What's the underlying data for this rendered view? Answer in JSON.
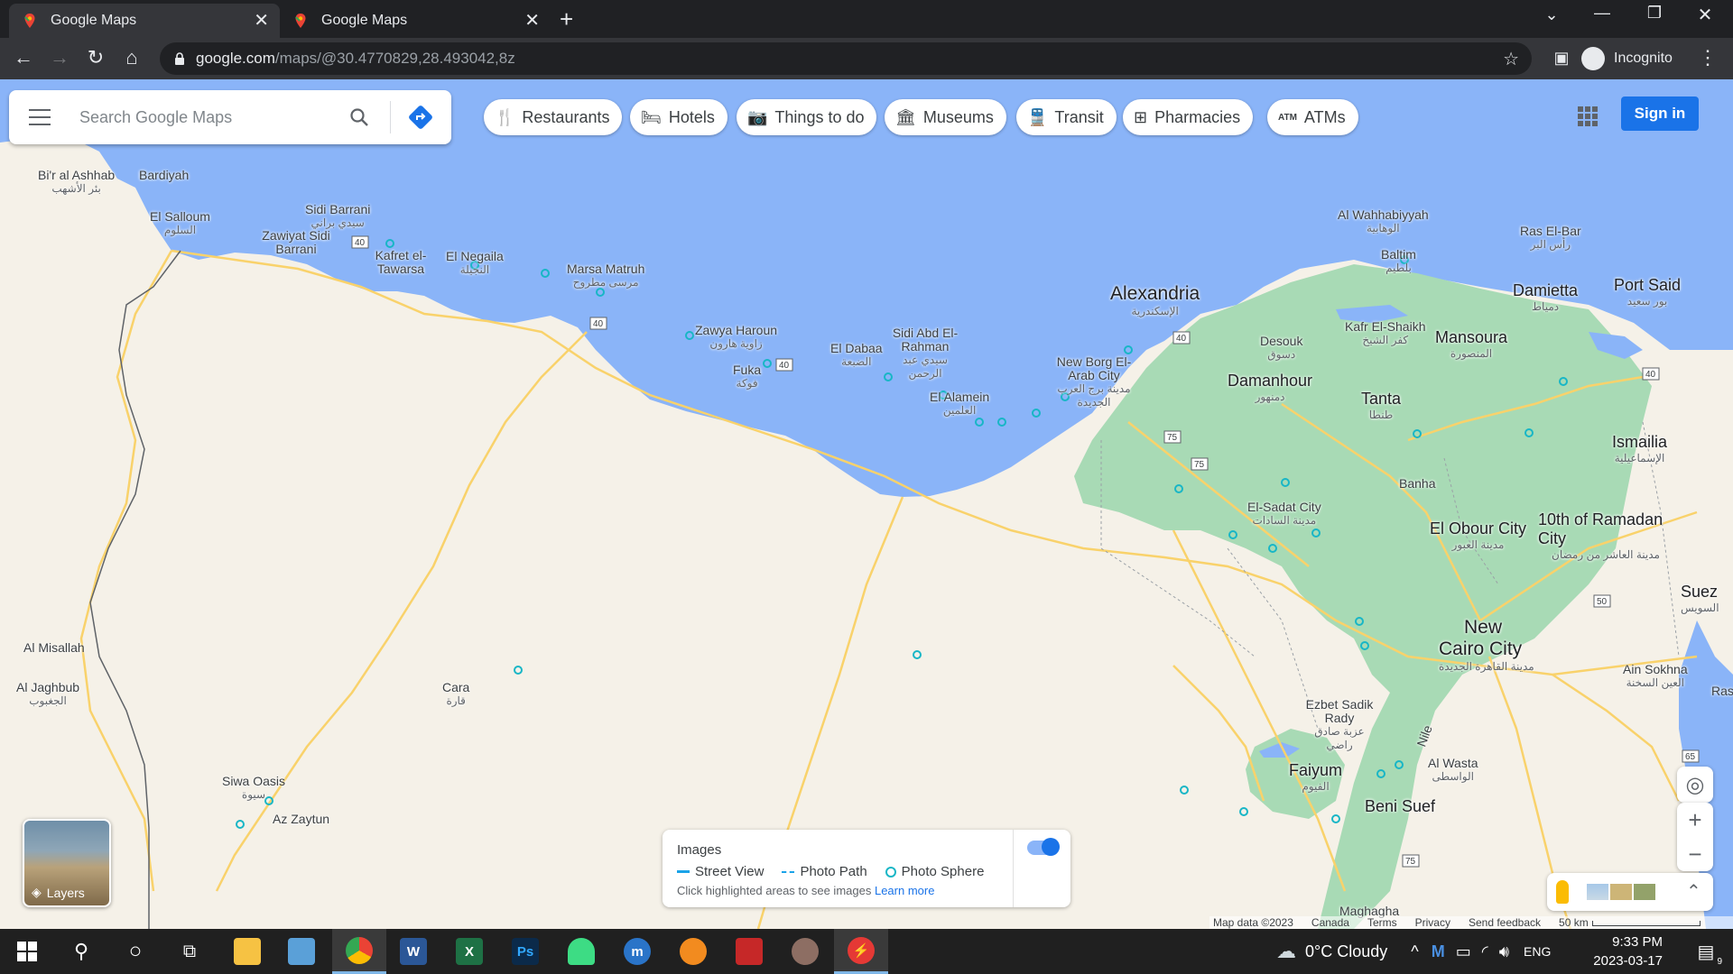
{
  "browser": {
    "tabs": [
      {
        "label": "Google Maps",
        "active": true
      },
      {
        "label": "Google Maps",
        "active": false
      }
    ],
    "url_host": "google.com",
    "url_path": "/maps/@30.4770829,28.493042,8z",
    "incognito_label": "Incognito"
  },
  "maps": {
    "search_placeholder": "Search Google Maps",
    "chips": [
      {
        "label": "Restaurants",
        "icon": "fork-knife-icon"
      },
      {
        "label": "Hotels",
        "icon": "bed-icon"
      },
      {
        "label": "Things to do",
        "icon": "camera-icon"
      },
      {
        "label": "Museums",
        "icon": "museum-icon"
      },
      {
        "label": "Transit",
        "icon": "train-icon"
      },
      {
        "label": "Pharmacies",
        "icon": "pharmacy-icon"
      },
      {
        "label": "ATMs",
        "icon": "atm-icon"
      }
    ],
    "signin_label": "Sign in",
    "layers_label": "Layers",
    "images_panel": {
      "title": "Images",
      "street_view": "Street View",
      "photo_path": "Photo Path",
      "photo_sphere": "Photo Sphere",
      "hint": "Click highlighted areas to see images",
      "learn_more": "Learn more"
    },
    "footer": {
      "map_data": "Map data ©2023",
      "region": "Canada",
      "terms": "Terms",
      "privacy": "Privacy",
      "feedback": "Send feedback",
      "scale": "50 km"
    },
    "places": {
      "alexandria": {
        "name": "Alexandria",
        "ar": "الإسكندرية"
      },
      "cairo1": {
        "name": "New",
        "ar": ""
      },
      "cairo2": {
        "name": "Cairo City",
        "ar": "مدينة القاهرة الجديدة"
      },
      "mansoura": {
        "name": "Mansoura",
        "ar": "المنصورة"
      },
      "damanhour": {
        "name": "Damanhour",
        "ar": "دمنهور"
      },
      "tanta": {
        "name": "Tanta",
        "ar": "طنطا"
      },
      "damietta": {
        "name": "Damietta",
        "ar": "دمياط"
      },
      "portsaid": {
        "name": "Port Said",
        "ar": "بور سعيد"
      },
      "ismailia": {
        "name": "Ismailia",
        "ar": "الإسماعيلية"
      },
      "obour": {
        "name": "El Obour City",
        "ar": "مدينة العبور"
      },
      "ramadan": {
        "name": "10th of Ramadan City",
        "ar": "مدينة العاشر من رمضان"
      },
      "suez": {
        "name": "Suez",
        "ar": "السويس"
      },
      "faiyum": {
        "name": "Faiyum",
        "ar": "الفيوم"
      },
      "benisuef": {
        "name": "Beni Suef",
        "ar": ""
      },
      "marsa": {
        "name": "Marsa Matruh",
        "ar": "مرسى مطروح"
      },
      "siwa": {
        "name": "Siwa Oasis",
        "ar": "سيوة"
      },
      "sidibarrani": {
        "name": "Sidi Barrani",
        "ar": "سيدي براني"
      },
      "salloum": {
        "name": "El Salloum",
        "ar": "السلوم"
      },
      "bardiyah": {
        "name": "Bardiyah",
        "ar": ""
      },
      "biralashhab": {
        "name": "Bi'r al Ashhab",
        "ar": "بئر الأشهب"
      },
      "zawiyat": {
        "name": "Zawiyat Sidi Barrani",
        "ar": ""
      },
      "kafret": {
        "name": "Kafret el-Tawarsa",
        "ar": ""
      },
      "negaila": {
        "name": "El Negaila",
        "ar": "النجيلة"
      },
      "zawya": {
        "name": "Zawya Haroun",
        "ar": "زاوية هارون"
      },
      "fuka": {
        "name": "Fuka",
        "ar": "فوكة"
      },
      "dabaa": {
        "name": "El Dabaa",
        "ar": "الضبعة"
      },
      "sidiabd": {
        "name": "Sidi Abd El-Rahman",
        "ar": "سيدي عبد الرحمن"
      },
      "alamein": {
        "name": "El Alamein",
        "ar": "العلمين"
      },
      "newborg": {
        "name": "New Borg El-Arab City",
        "ar": "مدينة برج العرب الجديدة"
      },
      "sadat": {
        "name": "El-Sadat City",
        "ar": "مدينة السادات"
      },
      "banha": {
        "name": "Banha",
        "ar": ""
      },
      "desouk": {
        "name": "Desouk",
        "ar": "دسوق"
      },
      "kafrsheikh": {
        "name": "Kafr El-Shaikh",
        "ar": "كفر الشيخ"
      },
      "baltim": {
        "name": "Baltim",
        "ar": "بلطيم"
      },
      "wahhabiyyah": {
        "name": "Al Wahhabiyyah",
        "ar": "الوهابية"
      },
      "rasbar": {
        "name": "Ras El-Bar",
        "ar": "رأس البر"
      },
      "cara": {
        "name": "Cara",
        "ar": "قارة"
      },
      "azzaytun": {
        "name": "Az Zaytun",
        "ar": ""
      },
      "misallah": {
        "name": "Al Misallah",
        "ar": ""
      },
      "jaghbub": {
        "name": "Al Jaghbub",
        "ar": "الجغبوب"
      },
      "ezbet": {
        "name": "Ezbet Sadik Rady",
        "ar": "عزبة صادق راضي"
      },
      "wasta": {
        "name": "Al Wasta",
        "ar": "الواسطى"
      },
      "ainsokhna": {
        "name": "Ain Sokhna",
        "ar": "العين السخنة"
      },
      "nile": {
        "name": "Nile",
        "ar": ""
      },
      "maghagha": {
        "name": "Maghagha",
        "ar": ""
      },
      "ras": {
        "name": "Ras",
        "ar": ""
      }
    }
  },
  "taskbar": {
    "weather": "0°C  Cloudy",
    "lang": "ENG",
    "time": "9:33 PM",
    "date": "2023-03-17",
    "notif_count": "9"
  },
  "colors": {
    "water": "#8ab4f8",
    "desert": "#f5f1e8",
    "green": "#a8dab5",
    "road": "#f9d26b",
    "accent": "#1a73e8"
  }
}
